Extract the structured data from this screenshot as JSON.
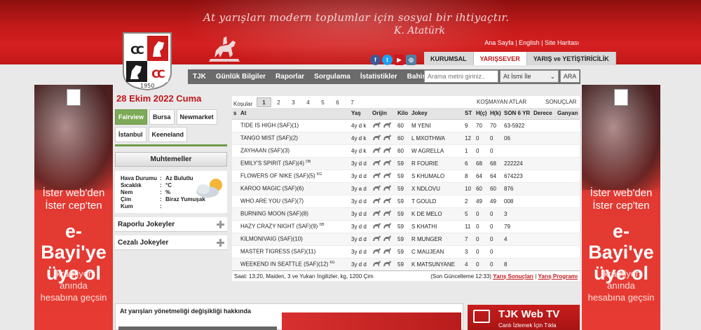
{
  "header": {
    "motto": "At yarışları modern toplumlar için sosyal bir ihtiyaçtır.",
    "signature": "K. Atatürk",
    "top_links": "Ana Sayfa | English | Site Haritası",
    "logo_year": "1950",
    "social": [
      {
        "icon": "facebook-icon",
        "glyph": "f"
      },
      {
        "icon": "twitter-icon",
        "glyph": "t"
      },
      {
        "icon": "youtube-icon",
        "glyph": "▶"
      },
      {
        "icon": "instagram-icon",
        "glyph": "◎"
      }
    ],
    "tabs": [
      "KURUMSAL",
      "YARIŞSEVER",
      "YARIŞ ve YETİŞTİRİCİLİK"
    ]
  },
  "nav": {
    "items": [
      "TJK",
      "Günlük Bilgiler",
      "Raporlar",
      "Sorgulama",
      "İstatistikler",
      "Bahis Yap"
    ],
    "search_placeholder": "Arama metni giriniz..",
    "search_select": "At İsmi İle",
    "search_button": "ARA"
  },
  "sidebar": {
    "date": "28 Ekim 2022 Cuma",
    "hippodromes": [
      "Fairview",
      "Bursa",
      "Newmarket",
      "İstanbul",
      "Keeneland"
    ],
    "muhtemeller": "Muhtemeller",
    "weather": [
      {
        "label": "Hava Durumu",
        "value": "Az Bulutlu"
      },
      {
        "label": "Sıcaklık",
        "value": "°C"
      },
      {
        "label": "Nem",
        "value": "%"
      },
      {
        "label": "Çim",
        "value": "Biraz Yumuşak"
      },
      {
        "label": "Kum",
        "value": ""
      }
    ],
    "accordions": [
      "Raporlu Jokeyler",
      "Cezalı Jokeyler"
    ]
  },
  "race": {
    "kosular_label": "Koşular",
    "tabs": [
      "1",
      "2",
      "3",
      "4",
      "5",
      "6",
      "7"
    ],
    "kosmayan": "KOŞMAYAN ATLAR",
    "sonuclar": "SONUÇLAR",
    "columns": [
      "s",
      "At",
      "Yaş",
      "Orijin",
      "Kilo",
      "Jokey",
      "ST",
      "H(ç)",
      "H(k)",
      "SON 6 YR",
      "Derece",
      "Ganyan"
    ],
    "rows": [
      {
        "at": "TIDE IS HIGH (SAF)(1)",
        "sup": "",
        "yas": "4y d k",
        "kilo": "60",
        "jokey": "M YENI",
        "st": "9",
        "hc": "70",
        "hk": "70",
        "son6": "63-5922"
      },
      {
        "at": "TANGO MIST (SAF)(2)",
        "sup": "",
        "yas": "4y d k",
        "kilo": "60",
        "jokey": "L MXOTHWA",
        "st": "12",
        "hc": "0",
        "hk": "0",
        "son6": "06"
      },
      {
        "at": "ZAYHAAN (SAF)(3)",
        "sup": "",
        "yas": "4y d k",
        "kilo": "60",
        "jokey": "W AGRELLA",
        "st": "1",
        "hc": "0",
        "hk": "0",
        "son6": ""
      },
      {
        "at": "EMILY'S SPIRIT (SAF)(4)",
        "sup": "DB",
        "yas": "3y d d",
        "kilo": "59",
        "jokey": "R FOURIE",
        "st": "6",
        "hc": "68",
        "hk": "68",
        "son6": "222224"
      },
      {
        "at": "FLOWERS OF NIKE (SAF)(5)",
        "sup": "KG",
        "yas": "3y d d",
        "kilo": "59",
        "jokey": "S KHUMALO",
        "st": "8",
        "hc": "64",
        "hk": "64",
        "son6": "674223"
      },
      {
        "at": "KAROO MAGIC (SAF)(6)",
        "sup": "",
        "yas": "3y a d",
        "kilo": "59",
        "jokey": "X NDLOVU",
        "st": "10",
        "hc": "60",
        "hk": "60",
        "son6": "876"
      },
      {
        "at": "WHO ARE YOU (SAF)(7)",
        "sup": "",
        "yas": "3y d d",
        "kilo": "59",
        "jokey": "T GOULD",
        "st": "2",
        "hc": "49",
        "hk": "49",
        "son6": "008"
      },
      {
        "at": "BURNING MOON (SAF)(8)",
        "sup": "",
        "yas": "3y d d",
        "kilo": "59",
        "jokey": "K DE MELO",
        "st": "5",
        "hc": "0",
        "hk": "0",
        "son6": "3"
      },
      {
        "at": "HAZY CRAZY NIGHT (SAF)(9)",
        "sup": "DB",
        "yas": "3y d d",
        "kilo": "59",
        "jokey": "S KHATHI",
        "st": "11",
        "hc": "0",
        "hk": "0",
        "son6": "79"
      },
      {
        "at": "KILMONIVAIG (SAF)(10)",
        "sup": "",
        "yas": "3y d d",
        "kilo": "59",
        "jokey": "R MUNGER",
        "st": "7",
        "hc": "0",
        "hk": "0",
        "son6": "4"
      },
      {
        "at": "MASTER TIGRESS (SAF)(11)",
        "sup": "",
        "yas": "3y d d",
        "kilo": "59",
        "jokey": "C MAUJEAN",
        "st": "3",
        "hc": "0",
        "hk": "0",
        "son6": ""
      },
      {
        "at": "WEEKEND IN SEATTLE (SAF)(12)",
        "sup": "KG",
        "yas": "3y d d",
        "kilo": "59",
        "jokey": "K MATSUNYANE",
        "st": "4",
        "hc": "0",
        "hk": "0",
        "son6": "8"
      }
    ],
    "info": "Saat: 13:20, Maiden, 3 ve Yukarı İngilizler, kg, 1200 Çim",
    "updated": "(Son Güncelleme 12:33)",
    "link_results": "Yarış Sonuçları",
    "link_sep": " | ",
    "link_program": "Yarış Programı"
  },
  "banner": {
    "line1a": "İster web'den",
    "line1b": "İster cep'ten",
    "line2a": "e-Bayi'ye",
    "line2b": "üye ol",
    "line3a": "İkramiyen",
    "line3b": "anında",
    "line3c": "hesabına geçsin"
  },
  "bottom": {
    "news_title": "At yarışları yönetmeliği değişikliği hakkında",
    "tv_title": "TJK Web TV",
    "tv_sub": "Canlı İzlemek İçin Tıkla"
  }
}
